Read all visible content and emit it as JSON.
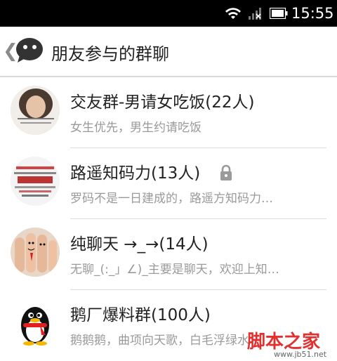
{
  "status_bar": {
    "time": "15:55",
    "icons": [
      "wifi-icon",
      "signal-icon",
      "battery-icon"
    ]
  },
  "header": {
    "back_glyph": "❮",
    "title": "朋友参与的群聊"
  },
  "groups": [
    {
      "name": "交友群-男请女吃饭(22人)",
      "desc": "女生优先，男生约请吃饭",
      "avatar": "photo-avatar",
      "locked": false
    },
    {
      "name": "路遥知码力(13人)",
      "desc": "罗码不是一日建成的，路遥方知码力…",
      "avatar": "source-code-avatar",
      "locked": true
    },
    {
      "name": "纯聊天 →_→(14人)",
      "desc": "无聊_(:_」∠)_主要是聊天，欢迎上知…",
      "avatar": "finger-faces-avatar",
      "locked": false
    },
    {
      "name": "鹅厂爆料群(100人)",
      "desc": "鹅鹅鹅，曲项向天歌，白毛浮绿水",
      "avatar": "qq-penguin-avatar",
      "locked": false
    }
  ],
  "watermark": {
    "text": "脚本之家",
    "url": "www.jb51.net"
  },
  "colors": {
    "status_bar_bg": "#000000",
    "title_text": "#222222",
    "desc_text": "#9a9a9a",
    "divider": "#dcdcdc"
  }
}
